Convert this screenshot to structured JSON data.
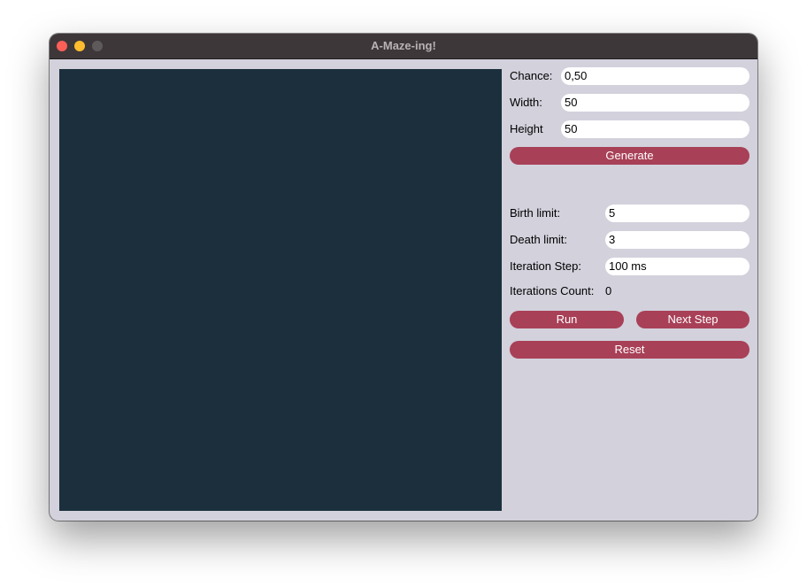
{
  "window": {
    "title": "A-Maze-ing!"
  },
  "controls": {
    "chance": {
      "label": "Chance:",
      "value": "0,50"
    },
    "width": {
      "label": "Width:",
      "value": "50"
    },
    "height": {
      "label": "Height",
      "value": "50"
    },
    "generate_label": "Generate",
    "birth_limit": {
      "label": "Birth limit:",
      "value": "5"
    },
    "death_limit": {
      "label": "Death limit:",
      "value": "3"
    },
    "iteration_step": {
      "label": "Iteration Step:",
      "value": "100 ms"
    },
    "iterations_count": {
      "label": "Iterations Count:",
      "value": "0"
    },
    "run_label": "Run",
    "next_step_label": "Next Step",
    "reset_label": "Reset"
  },
  "colors": {
    "canvas": "#1b303c",
    "button": "#a84057",
    "panel": "#d2d1dc",
    "titlebar": "#3e3739"
  }
}
